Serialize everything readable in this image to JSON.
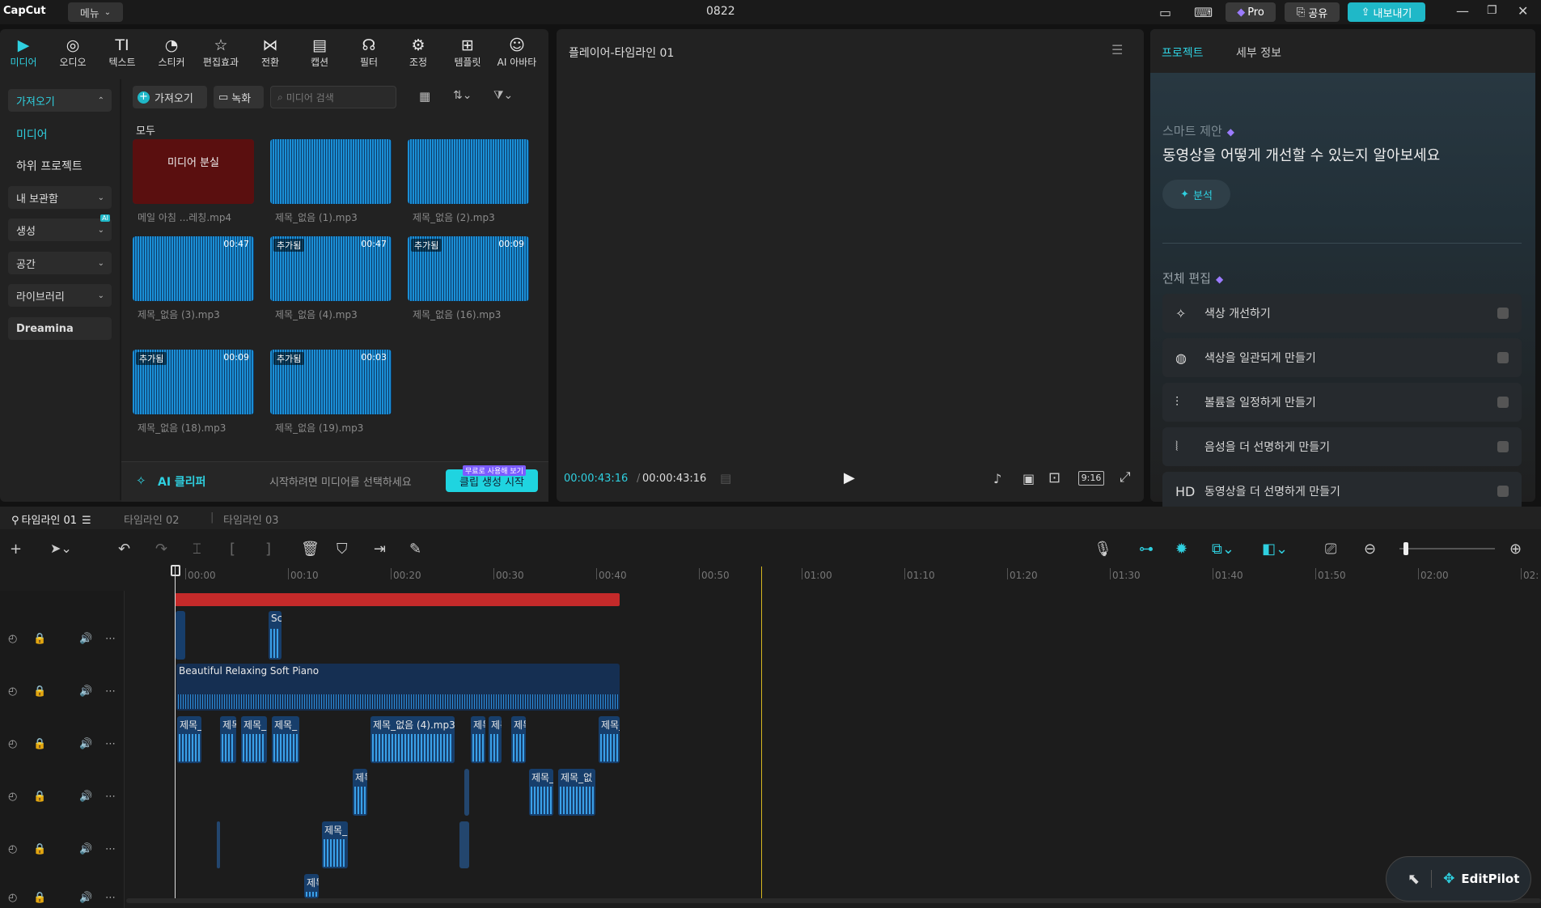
{
  "app": {
    "logo": "CapCut",
    "menu": "메뉴",
    "project_title": "0822",
    "pro": "Pro",
    "share": "공유",
    "export": "내보내기"
  },
  "toolbar": [
    {
      "label": "미디어",
      "icon": "media-icon"
    },
    {
      "label": "오디오",
      "icon": "audio-icon"
    },
    {
      "label": "텍스트",
      "icon": "text-icon"
    },
    {
      "label": "스티커",
      "icon": "sticker-icon"
    },
    {
      "label": "편집효과",
      "icon": "effects-icon"
    },
    {
      "label": "전환",
      "icon": "transition-icon"
    },
    {
      "label": "캡션",
      "icon": "caption-icon"
    },
    {
      "label": "필터",
      "icon": "filter-icon"
    },
    {
      "label": "조정",
      "icon": "adjust-icon"
    },
    {
      "label": "템플릿",
      "icon": "template-icon"
    },
    {
      "label": "AI 아바타",
      "icon": "ai-avatar-icon"
    }
  ],
  "sidebar": {
    "import": "가져오기",
    "media": "미디어",
    "sub_project": "하위 프로젝트",
    "my_library": "내 보관함",
    "generate": "생성",
    "space": "공간",
    "library": "라이브러리",
    "dreamina": "Dreamina",
    "ai_badge": "AI"
  },
  "media": {
    "import_btn": "가져오기",
    "record_btn": "녹화",
    "search_placeholder": "미디어 검색",
    "section": "모두",
    "items": [
      {
        "name": "메일 아침 ...레칭.mp4",
        "missing": "미디어 분실"
      },
      {
        "name": "제목_없음 (1).mp3"
      },
      {
        "name": "제목_없음 (2).mp3"
      },
      {
        "name": "제목_없음 (3).mp3",
        "dur": "00:47"
      },
      {
        "name": "제목_없음 (4).mp3",
        "tag": "추가됨",
        "dur": "00:47"
      },
      {
        "name": "제목_없음 (16).mp3",
        "tag": "추가됨",
        "dur": "00:09"
      },
      {
        "name": "제목_없음 (18).mp3",
        "tag": "추가됨",
        "dur": "00:09"
      },
      {
        "name": "제목_없음 (19).mp3",
        "tag": "추가됨",
        "dur": "00:03"
      }
    ],
    "ai_clipper": "AI 클리퍼",
    "ai_hint": "시작하려면 미디어를 선택하세요",
    "ai_start": "클립 생성 시작",
    "free_badge": "무료로 사용해 보기"
  },
  "player": {
    "title": "플레이어-타임라인 01",
    "current": "00:00:43:16",
    "total": "00:00:43:16",
    "ratio": "9:16"
  },
  "right": {
    "tab_project": "프로젝트",
    "tab_details": "세부 정보",
    "smart_title": "스마트 제안",
    "smart_heading": "동영상을 어떻게 개선할 수 있는지 알아보세요",
    "analyze": "분석",
    "full_edit": "전체 편집",
    "rows": [
      {
        "label": "색상 개선하기",
        "icon": "wand-icon"
      },
      {
        "label": "색상을 일관되게 만들기",
        "icon": "palette-icon"
      },
      {
        "label": "볼륨을 일정하게 만들기",
        "icon": "sliders-icon"
      },
      {
        "label": "음성을 더 선명하게 만들기",
        "icon": "voice-icon"
      },
      {
        "label": "동영상을 더 선명하게 만들기",
        "icon": "hd-icon"
      }
    ]
  },
  "timeline": {
    "tabs": [
      "타임라인 01",
      "타임라인 02",
      "타임라인 03"
    ],
    "ruler": [
      "00:00",
      "00:10",
      "00:20",
      "00:30",
      "00:40",
      "00:50",
      "01:00",
      "01:10",
      "01:20",
      "01:30",
      "01:40",
      "01:50",
      "02:00",
      "02:"
    ],
    "music_clip": "Beautiful Relaxing Soft Piano",
    "clip_sc": "Sc",
    "clip_short": "제목_",
    "clip_long": "제목_없음 (4).mp3",
    "clip_short2": "제목_없",
    "clip_tiny": "제목"
  },
  "editpilot": "EditPilot"
}
